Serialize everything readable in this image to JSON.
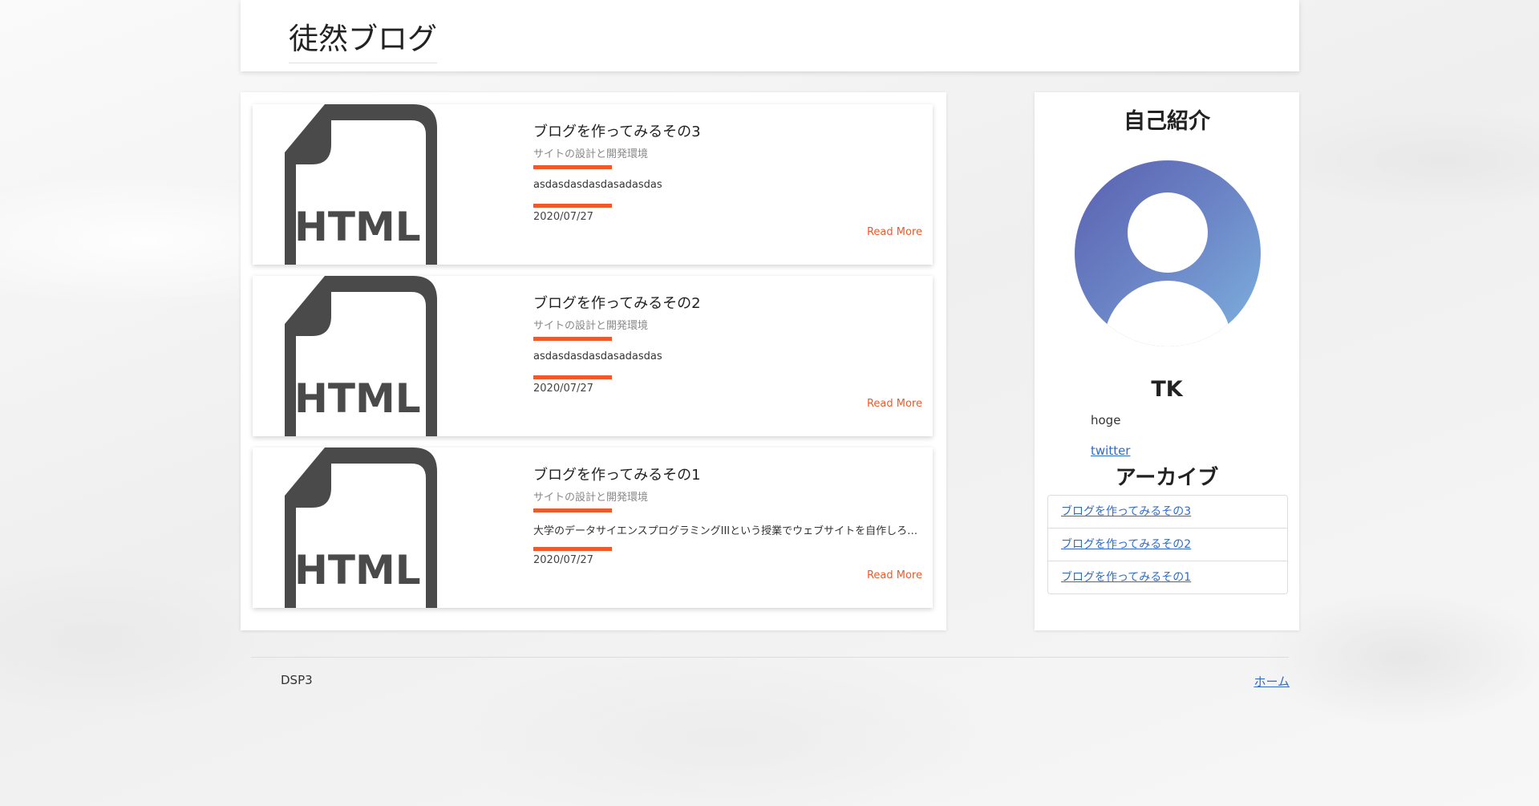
{
  "site": {
    "title": "徒然ブログ"
  },
  "posts": [
    {
      "title": "ブログを作ってみるその3",
      "subtitle": "サイトの設計と開発環境",
      "excerpt": "asdasdasdasdasadasdas",
      "date": "2020/07/27",
      "read_more": "Read More",
      "thumb_label": "HTML"
    },
    {
      "title": "ブログを作ってみるその2",
      "subtitle": "サイトの設計と開発環境",
      "excerpt": "asdasdasdasdasadasdas",
      "date": "2020/07/27",
      "read_more": "Read More",
      "thumb_label": "HTML"
    },
    {
      "title": "ブログを作ってみるその1",
      "subtitle": "サイトの設計と開発環境",
      "excerpt": "大学のデータサイエンスプログラミングIIIという授業でウェブサイトを自作しろという課題が...",
      "date": "2020/07/27",
      "read_more": "Read More",
      "thumb_label": "HTML"
    }
  ],
  "sidebar": {
    "profile_title": "自己紹介",
    "name": "TK",
    "bio": "hoge",
    "link": "twitter",
    "archive_title": "アーカイブ",
    "archive": [
      "ブログを作ってみるその3",
      "ブログを作ってみるその2",
      "ブログを作ってみるその1"
    ]
  },
  "footer": {
    "left": "DSP3",
    "home": "ホーム"
  },
  "colors": {
    "accent": "#f05a2a",
    "link": "#2f6cc9",
    "icon": "#4a4a4a"
  }
}
